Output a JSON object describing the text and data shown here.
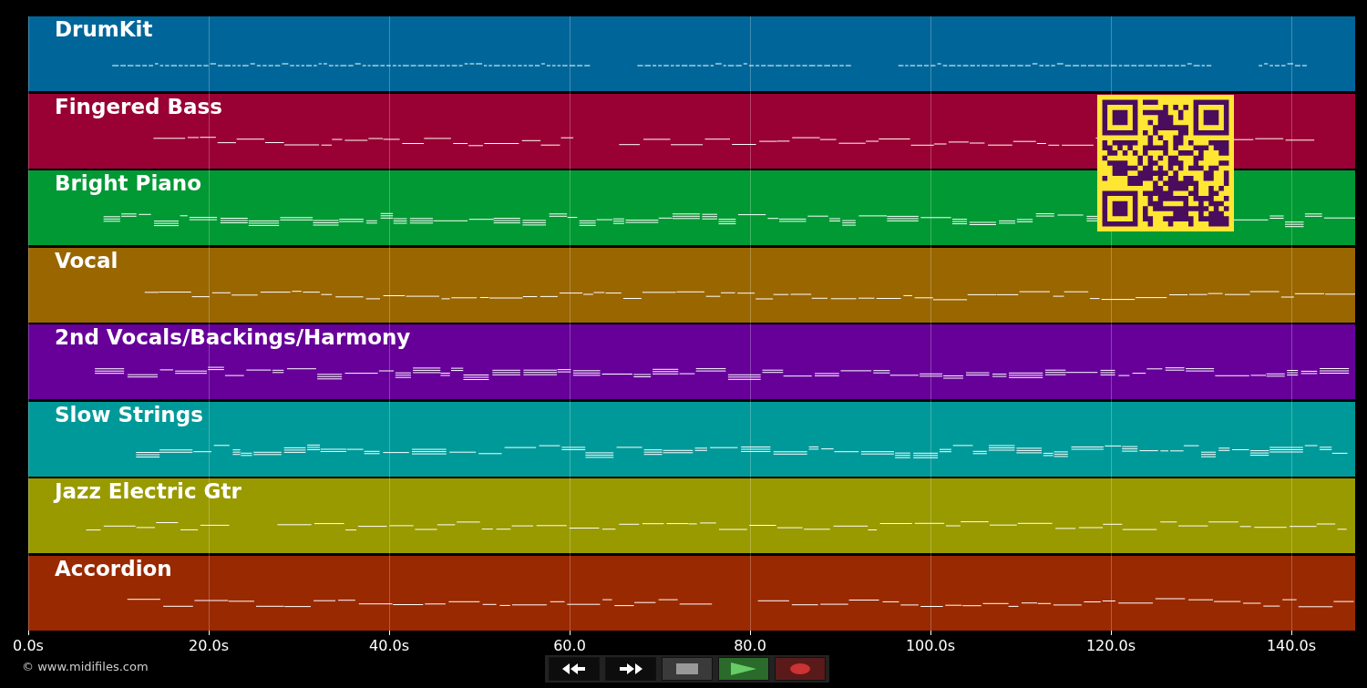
{
  "tracks": [
    {
      "name": "DrumKit",
      "color": "#006699",
      "kind": "drums"
    },
    {
      "name": "Fingered Bass",
      "color": "#990033",
      "kind": "melodic"
    },
    {
      "name": "Bright Piano",
      "color": "#009933",
      "kind": "chords"
    },
    {
      "name": "Vocal",
      "color": "#996600",
      "kind": "melodic"
    },
    {
      "name": "2nd Vocals/Backings/Harmony",
      "color": "#660099",
      "kind": "chords"
    },
    {
      "name": "Slow Strings",
      "color": "#009999",
      "kind": "chords"
    },
    {
      "name": "Jazz Electric Gtr",
      "color": "#999900",
      "kind": "melodic"
    },
    {
      "name": "Accordion",
      "color": "#992900",
      "kind": "melodic"
    }
  ],
  "time_axis": {
    "ticks": [
      "0.0s",
      "20.0s",
      "40.0s",
      "60.0",
      "80.0",
      "100.0s",
      "120.0s",
      "140.0s"
    ]
  },
  "transport": [
    {
      "kind": "rewind"
    },
    {
      "kind": "forward"
    },
    {
      "kind": "stop"
    },
    {
      "kind": "play"
    },
    {
      "kind": "record"
    }
  ],
  "footer": {
    "copyright": "© www.midifiles.com"
  }
}
